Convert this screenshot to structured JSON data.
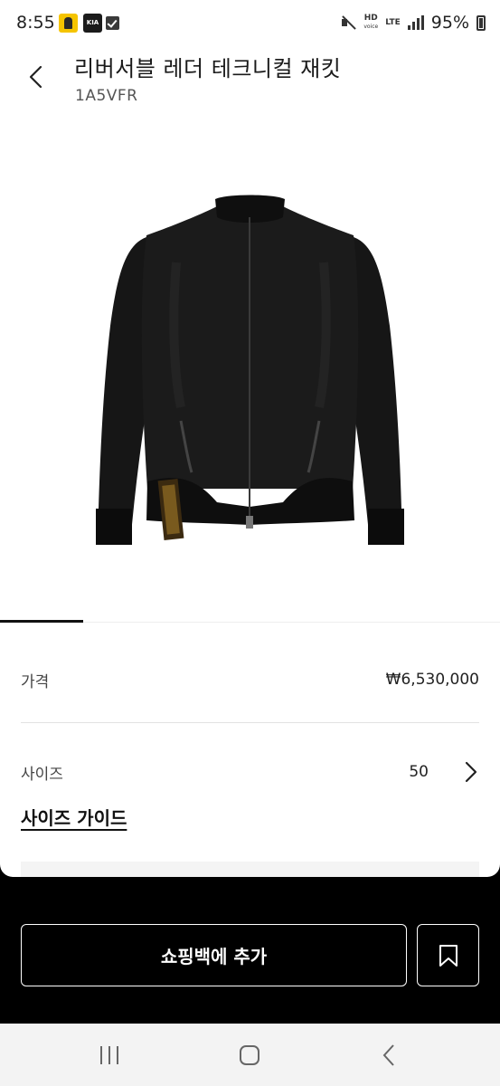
{
  "status_bar": {
    "time": "8:55",
    "apps": [
      "kakao-icon",
      "kia-connect-icon",
      "check-icon"
    ],
    "kia_label": "KIA",
    "hd_label": "HD",
    "voice_label": "voice",
    "lte_label": "LTE",
    "battery": "95%"
  },
  "product": {
    "title": "리버서블 레더 테크니컬 재킷",
    "sku": "1A5VFR",
    "image_icon": "black-leather-jacket-image"
  },
  "details": {
    "price_label": "가격",
    "price_value": "₩6,530,000",
    "size_label": "사이즈",
    "size_value": "50",
    "size_guide": "사이즈 가이드"
  },
  "actions": {
    "add_to_bag": "쇼핑백에 추가",
    "bookmark_icon": "bookmark-icon"
  },
  "navbar": {
    "recent_icon": "recent-apps-icon",
    "home_icon": "home-icon",
    "back_icon": "back-icon"
  },
  "colors": {
    "background": "#000000",
    "sheet": "#ffffff",
    "text": "#1a1a1a",
    "navbar": "#f3f3f3"
  }
}
